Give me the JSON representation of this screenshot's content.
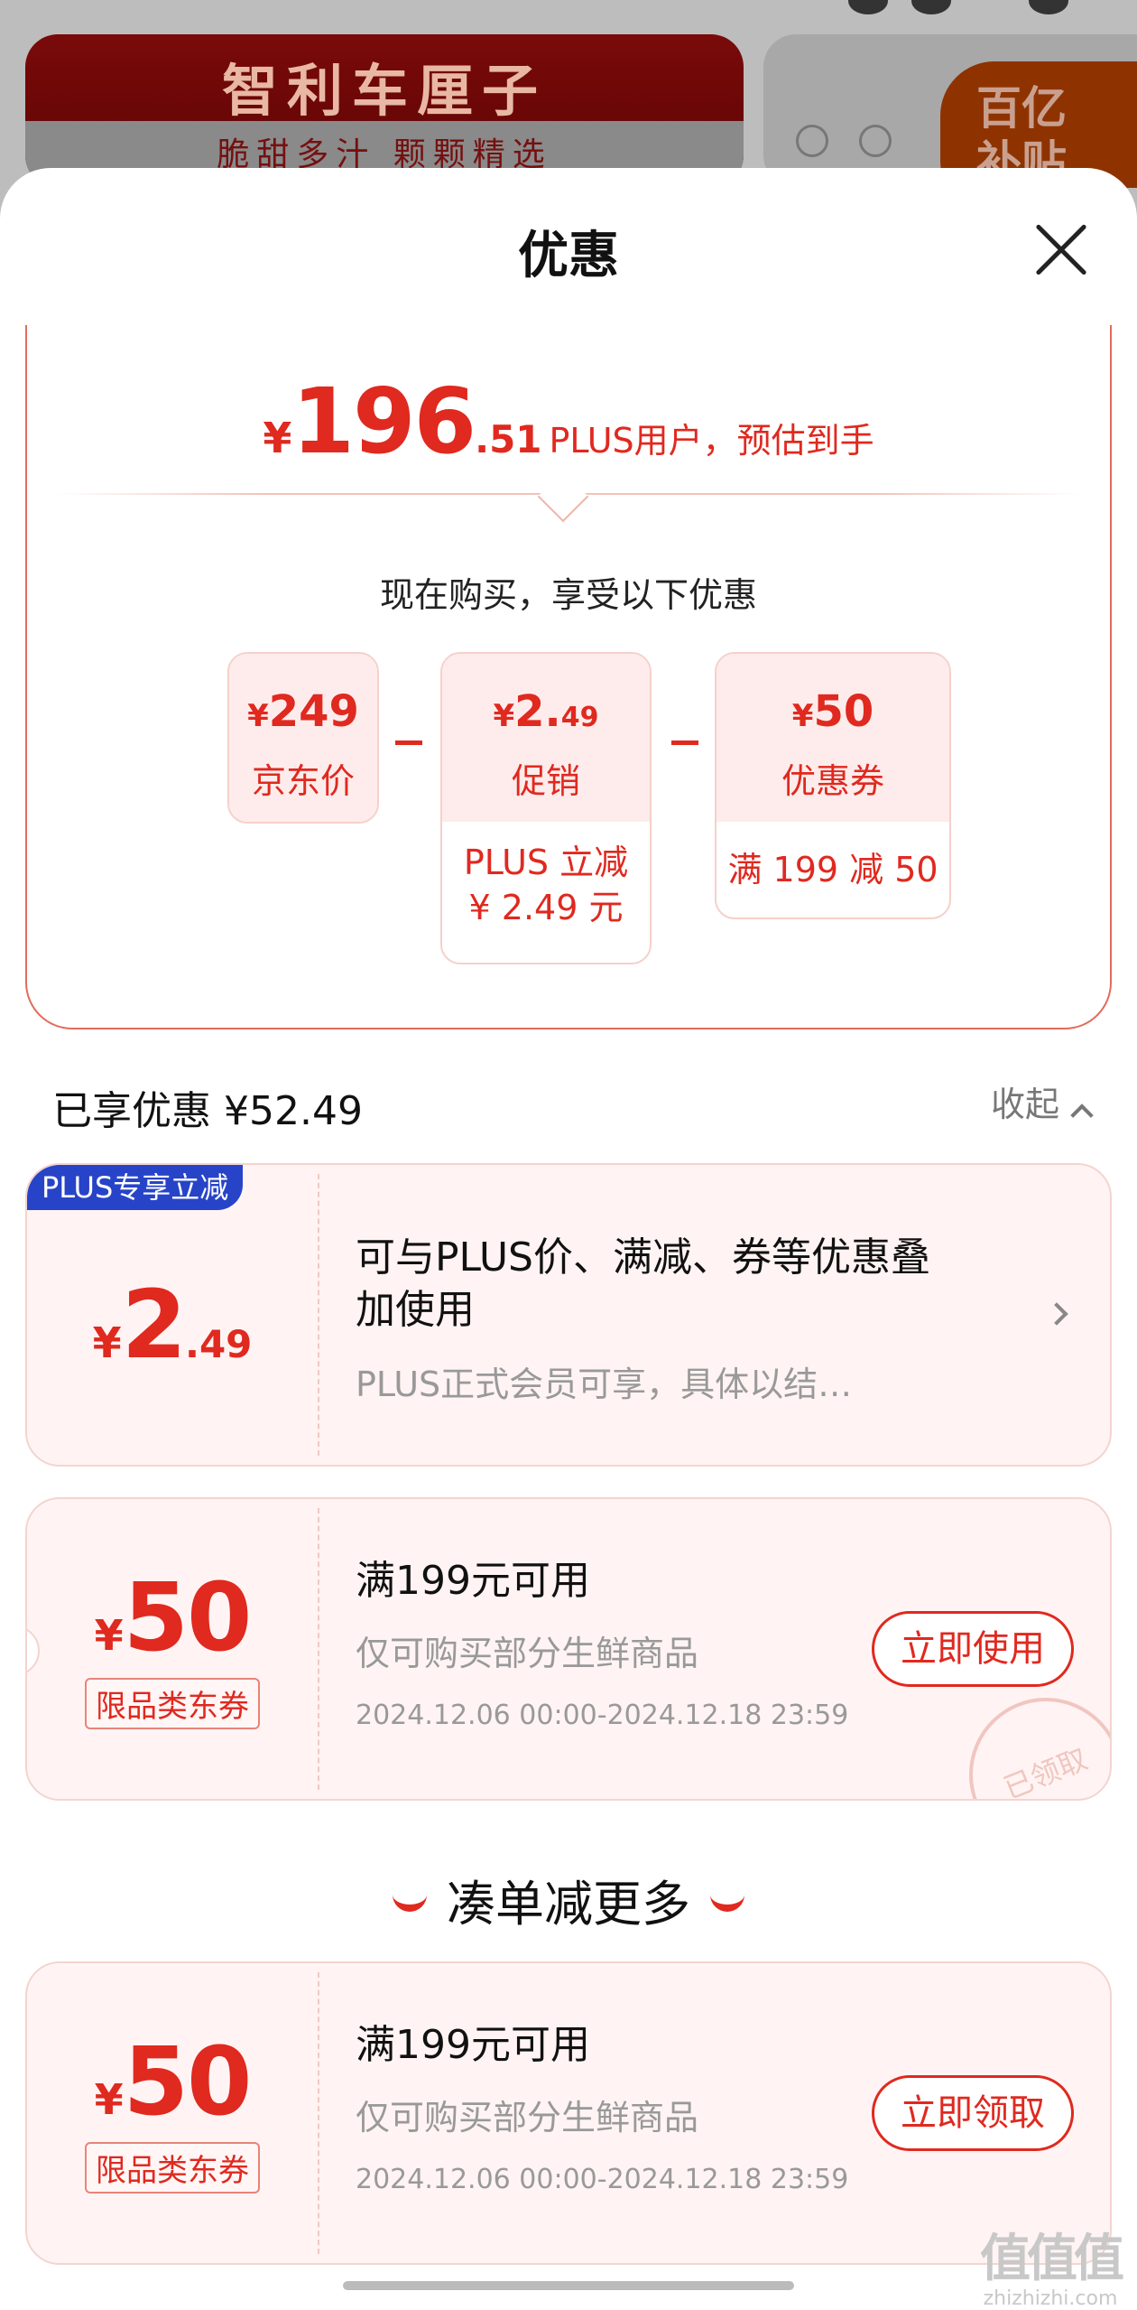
{
  "background": {
    "banner_title": "智利车厘子",
    "banner_subtitle": "脆甜多汁  颗颗精选",
    "right_badge": "百亿\n补贴"
  },
  "sheet": {
    "title": "优惠"
  },
  "summary": {
    "currency": "¥",
    "price_int": "196",
    "price_dec": ".51",
    "price_label": "PLUS用户，预估到手",
    "now_text": "现在购买，享受以下优惠",
    "boxes": [
      {
        "currency": "¥",
        "value": "249",
        "value_dec": "",
        "name": "京东价",
        "detail": ""
      },
      {
        "currency": "¥",
        "value": "2.",
        "value_dec": "49",
        "name": "促销",
        "detail": "PLUS 立减\n¥ 2.49 元"
      },
      {
        "currency": "¥",
        "value": "50",
        "value_dec": "",
        "name": "优惠券",
        "detail": "满 199 减 50"
      }
    ]
  },
  "enjoyed": {
    "label": "已享优惠 ¥52.49",
    "collapse_label": "收起"
  },
  "plus_card": {
    "tag": "PLUS专享立减",
    "currency": "¥",
    "amount_int": "2",
    "amount_dec": ".49",
    "title": "可与PLUS价、满减、券等优惠叠加使用",
    "subtitle": "PLUS正式会员可享，具体以结…"
  },
  "coupon_claimed": {
    "currency": "¥",
    "amount": "50",
    "tag": "限品类东券",
    "title": "满199元可用",
    "subtitle": "仅可购买部分生鲜商品",
    "date_range": "2024.12.06 00:00-2024.12.18 23:59",
    "button": "立即使用",
    "stamp": "已领取"
  },
  "more_section": {
    "title": "凑单减更多"
  },
  "coupon_more": {
    "currency": "¥",
    "amount": "50",
    "tag": "限品类东券",
    "title": "满199元可用",
    "subtitle": "仅可购买部分生鲜商品",
    "date_range": "2024.12.06 00:00-2024.12.18 23:59",
    "button": "立即领取"
  },
  "watermark": {
    "logo": "值值值",
    "site": "zhizhizhi.com"
  },
  "colors": {
    "accent": "#e0291f",
    "plus_tag": "#2744c8",
    "card_bg": "#fff4f3"
  }
}
